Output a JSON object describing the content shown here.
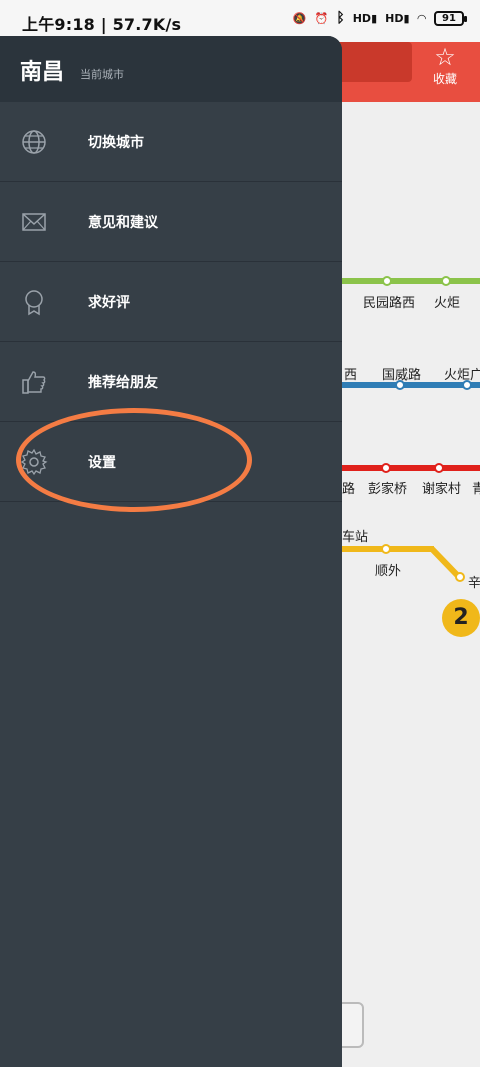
{
  "status": {
    "left": "上午9:18 | 57.7K/s",
    "battery": "91",
    "signal1": "HD",
    "signal2": "HD"
  },
  "map": {
    "favorite_label": "收藏",
    "badge": "2",
    "stations": {
      "s1": "民园路西",
      "s2": "火炬",
      "s3": "西",
      "s4": "国威路",
      "s5": "火炬广",
      "s6": "路",
      "s7": "彭家桥",
      "s8": "谢家村",
      "s9": "青",
      "s10": "车站",
      "s11": "顺外",
      "s12": "辛"
    },
    "colors": {
      "topbar": "#e84e40",
      "green_line": "#8bc34a",
      "blue_line": "#2f7db5",
      "red_line": "#e0211b",
      "yellow_line": "#f0b81a"
    }
  },
  "drawer": {
    "city": "南昌",
    "city_sub": "当前城市",
    "items": [
      {
        "label": "切换城市",
        "icon": "globe-icon"
      },
      {
        "label": "意见和建议",
        "icon": "mail-icon"
      },
      {
        "label": "求好评",
        "icon": "award-icon"
      },
      {
        "label": "推荐给朋友",
        "icon": "thumbs-up-icon"
      },
      {
        "label": "设置",
        "icon": "gear-icon"
      }
    ],
    "highlight_color": "#f47c44"
  }
}
